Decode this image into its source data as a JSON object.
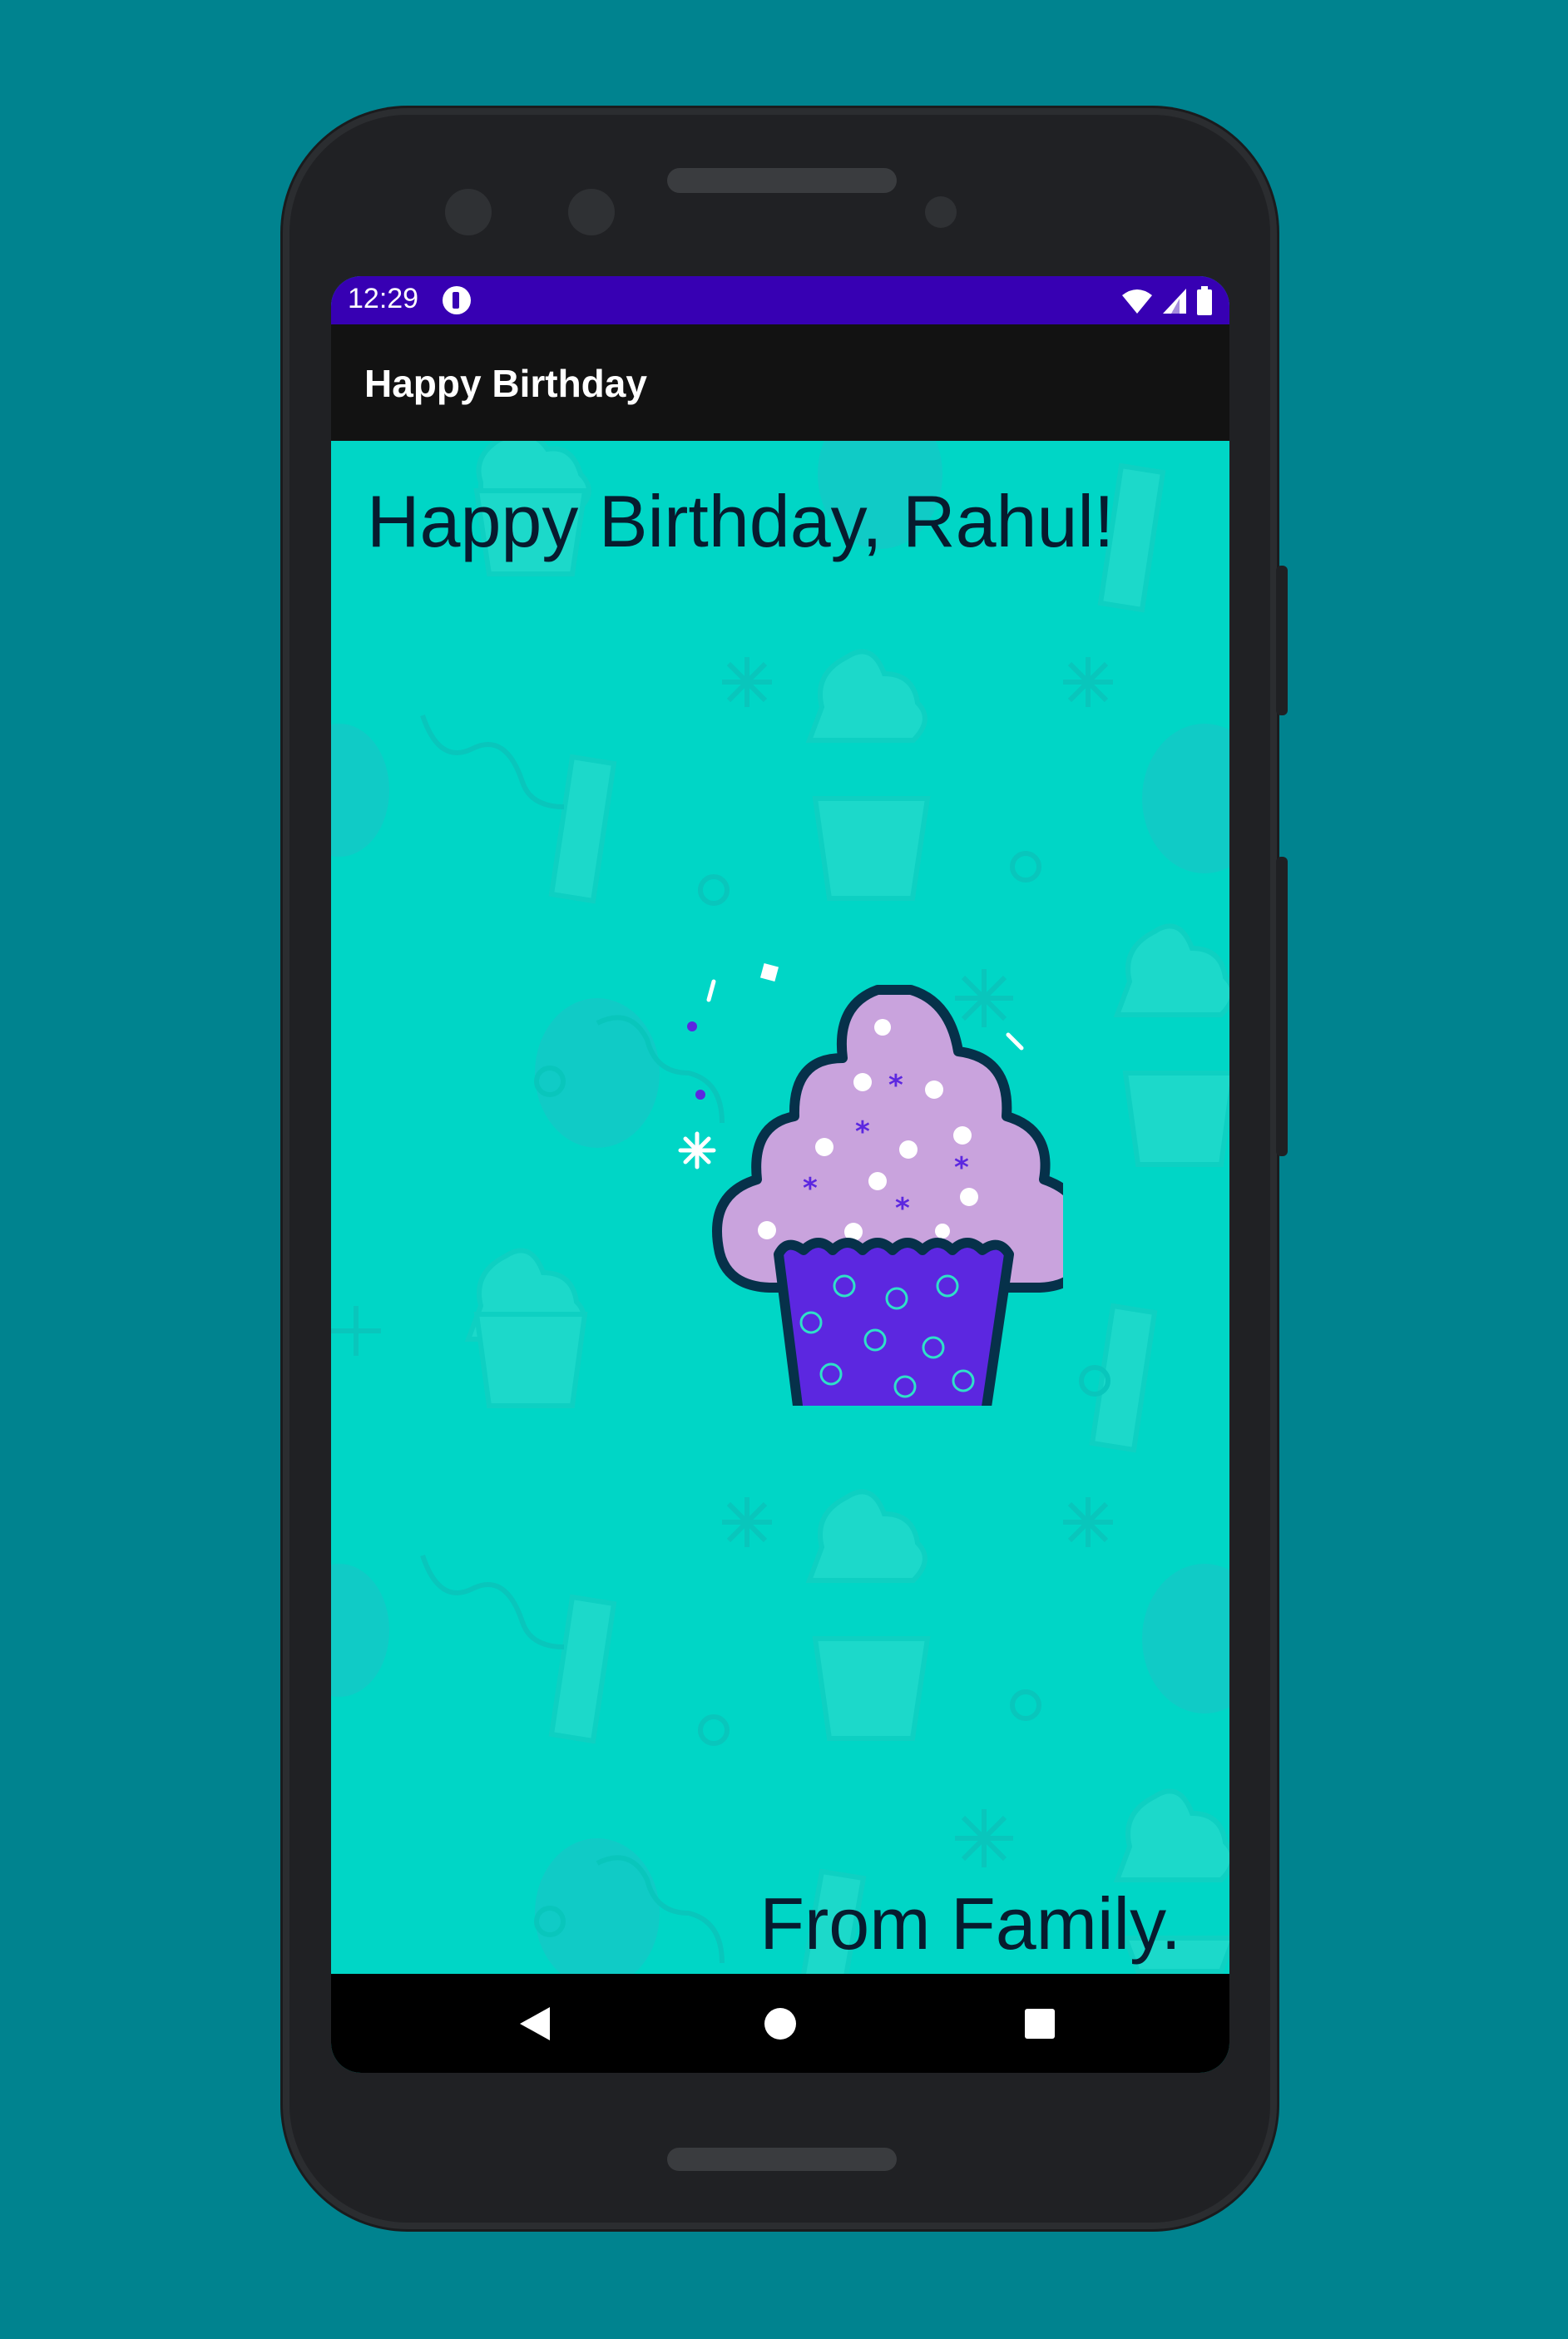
{
  "status_bar": {
    "time": "12:29",
    "app_icon": "notification-app-icon",
    "icons": [
      "wifi-icon",
      "cellular-signal-icon",
      "battery-icon"
    ]
  },
  "app_bar": {
    "title": "Happy Birthday"
  },
  "card": {
    "greeting": "Happy Birthday, Rahul!",
    "signature": "From Family.",
    "image": "cupcake-illustration",
    "background_color": "#00d6c6",
    "text_color": "#071b2e"
  },
  "nav_bar": {
    "back": "back-triangle-icon",
    "home": "home-circle-icon",
    "recents": "recents-square-icon"
  },
  "colors": {
    "page_background": "#00838f",
    "status_bar": "#3700b3",
    "app_bar": "#121212",
    "phone_body": "#202124",
    "cupcake_frosting": "#c9a3dd",
    "cupcake_wrapper": "#5c27e0"
  }
}
